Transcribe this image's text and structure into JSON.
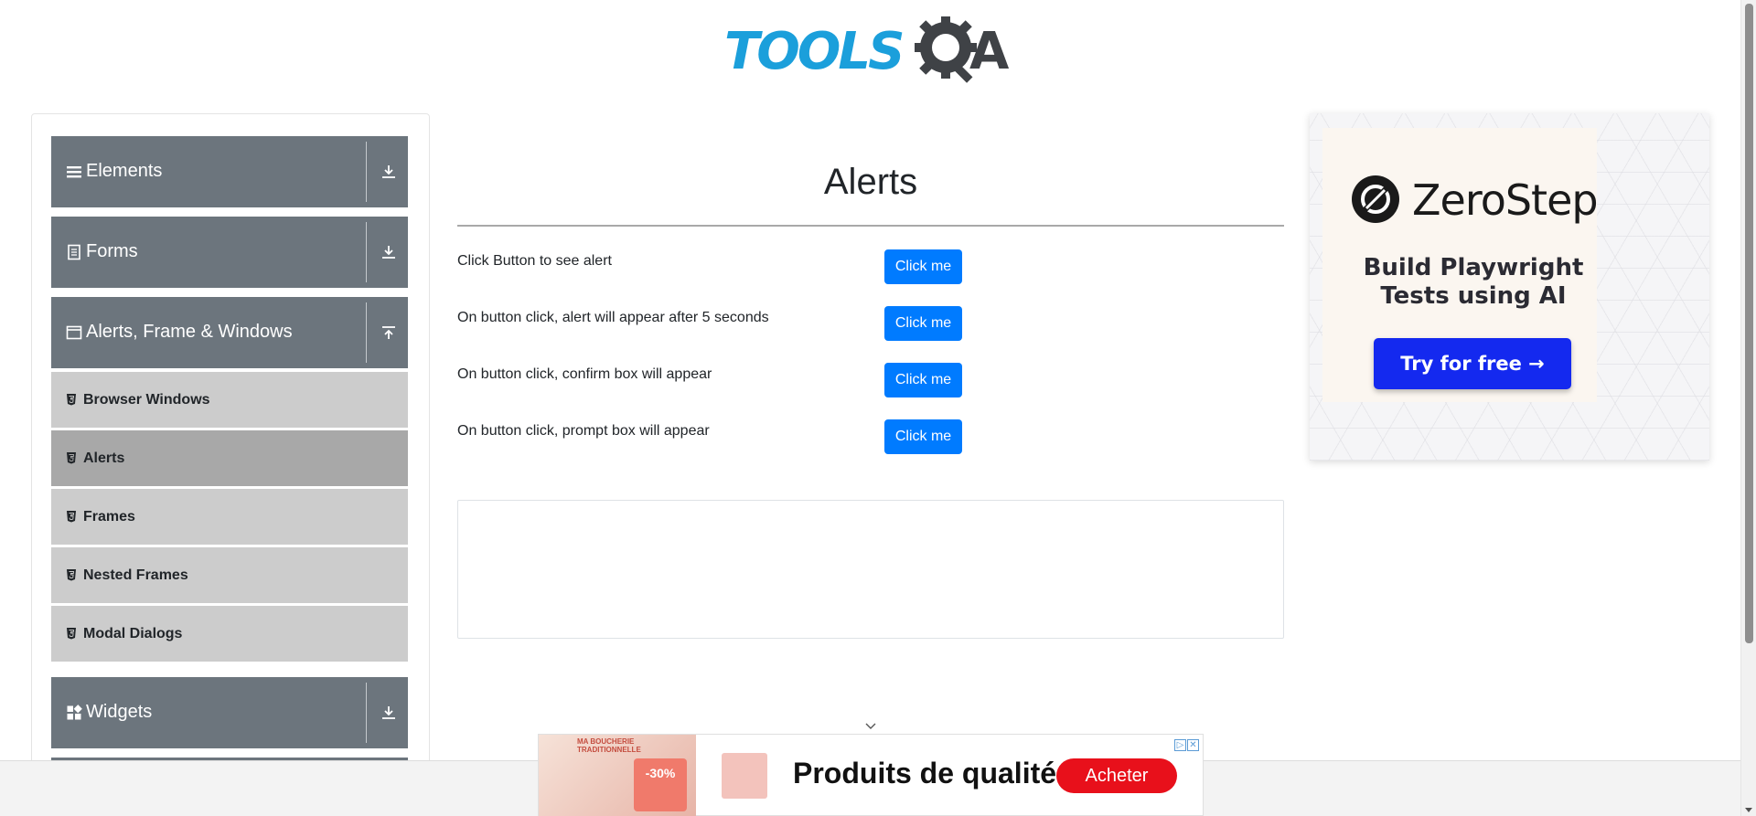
{
  "header": {
    "logo_text_left": "TOOLS",
    "logo_text_right": "A",
    "logo_colors": {
      "tools": "#1b9fdb",
      "qa": "#3f4246"
    }
  },
  "sidebar": {
    "groups": [
      {
        "label": "Elements",
        "icon": "hamburger-icon",
        "state_icon": "download-icon"
      },
      {
        "label": "Forms",
        "icon": "document-icon",
        "state_icon": "download-icon"
      },
      {
        "label": "Alerts, Frame & Windows",
        "icon": "window-icon",
        "state_icon": "upload-icon"
      },
      {
        "label": "Widgets",
        "icon": "grid-icon",
        "state_icon": "download-icon"
      }
    ],
    "items": [
      {
        "label": "Browser Windows",
        "active": false
      },
      {
        "label": "Alerts",
        "active": true
      },
      {
        "label": "Frames",
        "active": false
      },
      {
        "label": "Nested Frames",
        "active": false
      },
      {
        "label": "Modal Dialogs",
        "active": false
      }
    ],
    "colors": {
      "group_bg": "#6c757d",
      "item_bg": "#cccccc",
      "item_active_bg": "#a8a8a8"
    }
  },
  "main": {
    "title": "Alerts",
    "rows": [
      {
        "text": "Click Button to see alert",
        "button": "Click me"
      },
      {
        "text": "On button click, alert will appear after 5 seconds",
        "button": "Click me"
      },
      {
        "text": "On button click, confirm box will appear",
        "button": "Click me"
      },
      {
        "text": "On button click, prompt box will appear",
        "button": "Click me"
      }
    ],
    "button_color": "#007bff"
  },
  "ad_right": {
    "brand": "ZeroStep",
    "tagline_1": "Build Playwright",
    "tagline_2": "Tests using AI",
    "cta": "Try for free →",
    "cta_color": "#1429ef"
  },
  "ad_bottom": {
    "thumb_label": "MA BOUCHERIE TRADITIONNELLE",
    "thumb_badge": "-30%",
    "headline": "Produits de qualité",
    "cta": "Acheter",
    "cta_color": "#e8101b"
  }
}
